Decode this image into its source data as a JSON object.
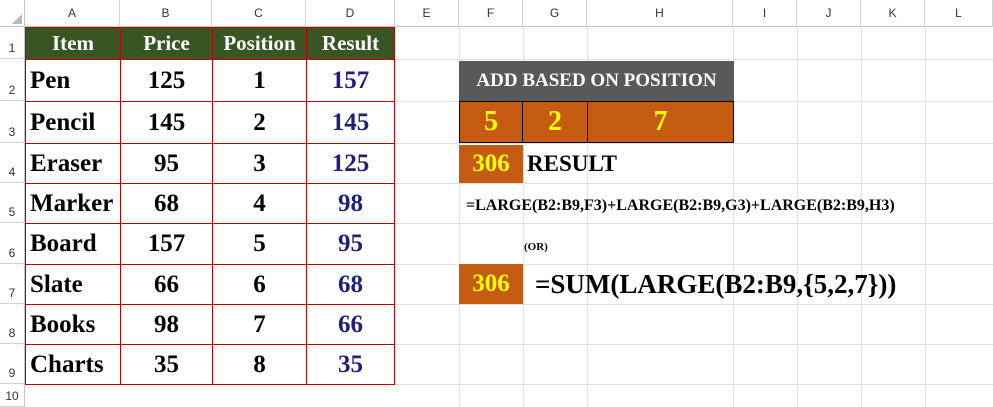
{
  "columns": [
    "A",
    "B",
    "C",
    "D",
    "E",
    "F",
    "G",
    "H",
    "I",
    "J",
    "K",
    "L"
  ],
  "rows": [
    "1",
    "2",
    "3",
    "4",
    "5",
    "6",
    "7",
    "8",
    "9",
    "10"
  ],
  "table": {
    "headers": [
      "Item",
      "Price",
      "Position",
      "Result"
    ],
    "rows": [
      {
        "item": "Pen",
        "price": "125",
        "position": "1",
        "result": "157"
      },
      {
        "item": "Pencil",
        "price": "145",
        "position": "2",
        "result": "145"
      },
      {
        "item": "Eraser",
        "price": "95",
        "position": "3",
        "result": "125"
      },
      {
        "item": "Marker",
        "price": "68",
        "position": "4",
        "result": "98"
      },
      {
        "item": "Board",
        "price": "157",
        "position": "5",
        "result": "95"
      },
      {
        "item": "Slate",
        "price": "66",
        "position": "6",
        "result": "68"
      },
      {
        "item": "Books",
        "price": "98",
        "position": "7",
        "result": "66"
      },
      {
        "item": "Charts",
        "price": "35",
        "position": "8",
        "result": "35"
      }
    ]
  },
  "panel": {
    "title": "ADD BASED ON POSITION",
    "positions": [
      "5",
      "2",
      "7"
    ],
    "result_value": "306",
    "result_label": "RESULT",
    "formula1": "=LARGE(B2:B9,F3)+LARGE(B2:B9,G3)+LARGE(B2:B9,H3)",
    "or_label": "(OR)",
    "result_value2": "306",
    "formula2": "=SUM(LARGE(B2:B9,{5,2,7}))"
  },
  "colors": {
    "header_green": "#375623",
    "border_red": "#c00000",
    "result_blue": "#1f1f7a",
    "title_gray": "#595959",
    "accent_orange": "#c55a11",
    "accent_yellow": "#ffff00"
  }
}
